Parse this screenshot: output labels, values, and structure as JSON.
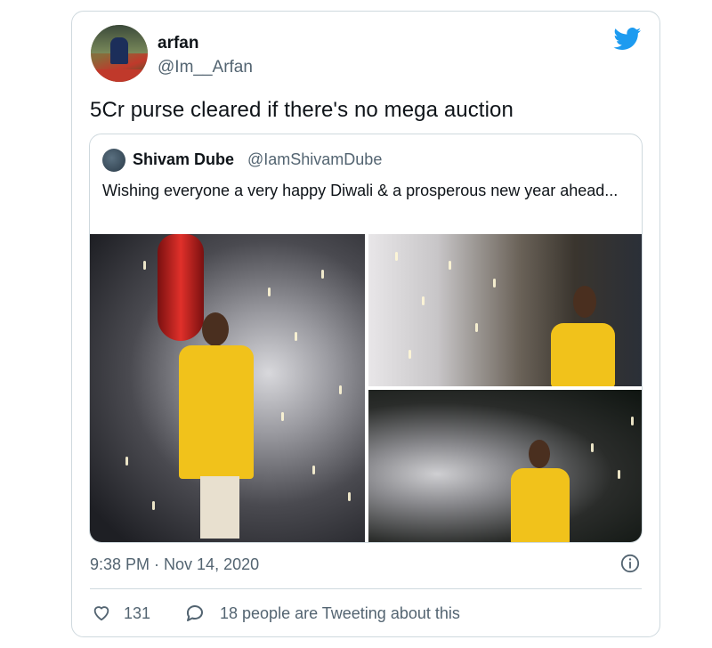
{
  "tweet": {
    "author_name": "arfan",
    "author_handle": "@Im__Arfan",
    "text": "5Cr purse cleared if there's no mega auction",
    "timestamp": "9:38 PM · Nov 14, 2020",
    "likes": "131",
    "tweeting_text": "18 people are Tweeting about this"
  },
  "quoted_tweet": {
    "author_name": "Shivam Dube",
    "author_handle": "@IamShivamDube",
    "text": "Wishing everyone a very happy Diwali & a prosperous new year ahead..."
  },
  "icons": {
    "brand": "twitter-bird-icon",
    "info": "info-icon",
    "like": "heart-icon",
    "reply": "speech-bubble-icon"
  },
  "colors": {
    "brand_blue": "#1d9bf0",
    "secondary_text": "#536471",
    "border": "#cfd9de"
  }
}
